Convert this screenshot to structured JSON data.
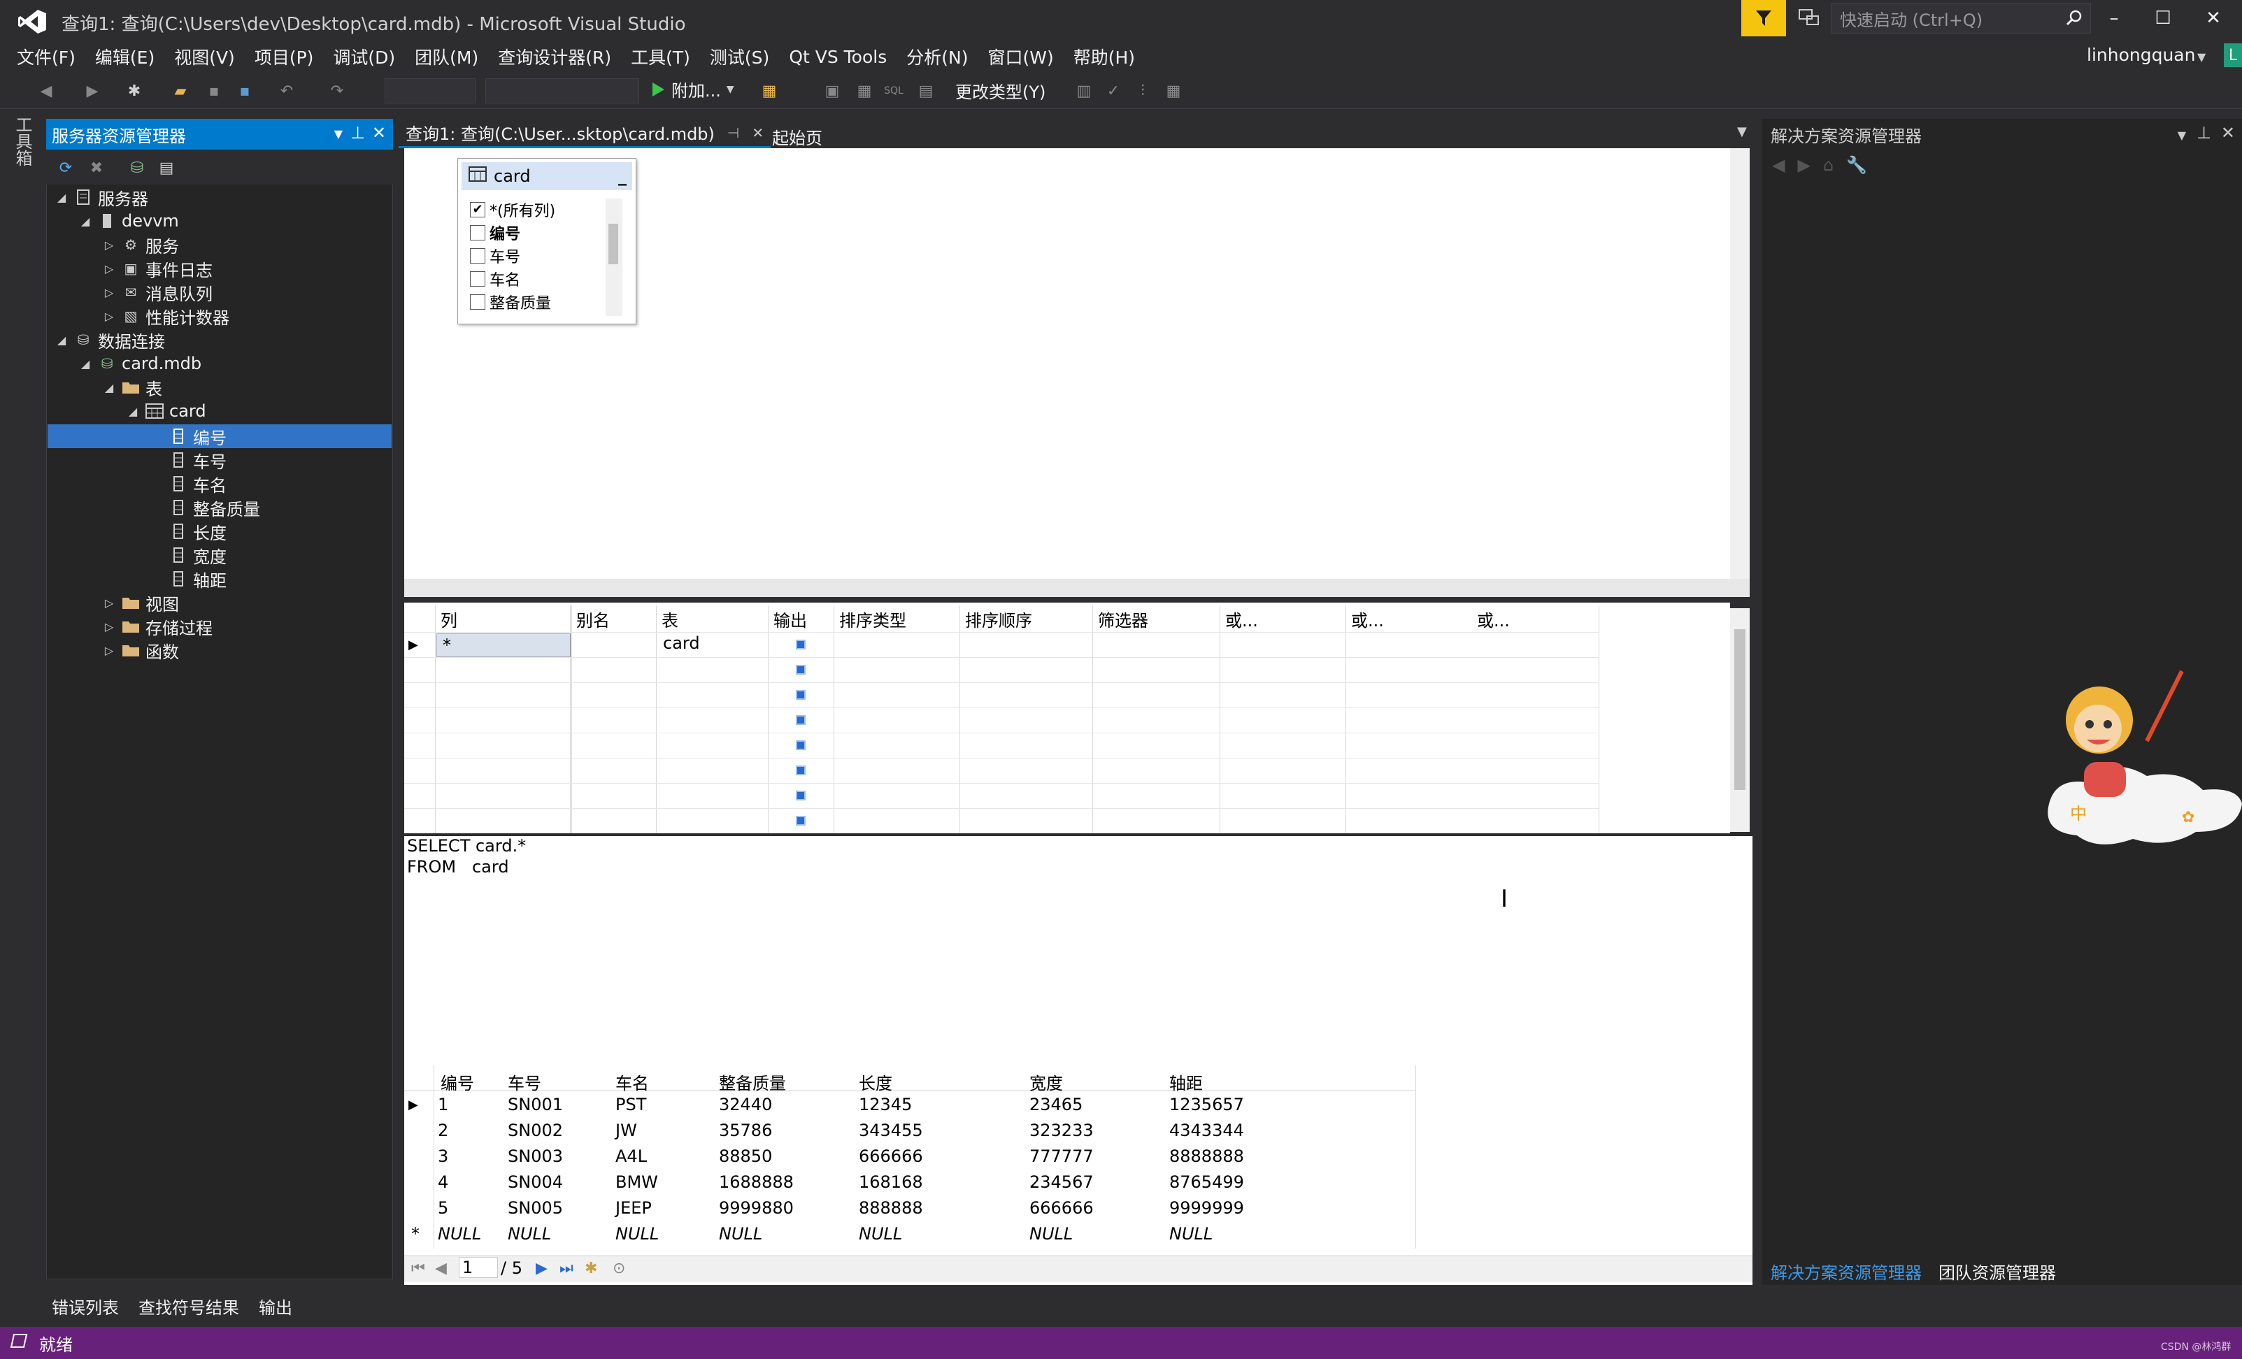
{
  "window": {
    "title": "查询1: 查询(C:\\Users\\dev\\Desktop\\card.mdb) - Microsoft Visual Studio",
    "quick_launch_placeholder": "快速启动 (Ctrl+Q)",
    "minimize": "–",
    "maximize": "☐",
    "close": "✕"
  },
  "menu": [
    "文件(F)",
    "编辑(E)",
    "视图(V)",
    "项目(P)",
    "调试(D)",
    "团队(M)",
    "查询设计器(R)",
    "工具(T)",
    "测试(S)",
    "Qt VS Tools",
    "分析(N)",
    "窗口(W)",
    "帮助(H)"
  ],
  "user": {
    "name": "linhongquan",
    "badge": "L"
  },
  "toolbar": {
    "attach_label": "附加...",
    "change_type_label": "更改类型(Y)"
  },
  "toolbox_label": "工具箱",
  "server_explorer": {
    "title": "服务器资源管理器",
    "tree": [
      {
        "label": "服务器",
        "level": 0,
        "expanded": true,
        "icon": "server-icon"
      },
      {
        "label": "devvm",
        "level": 1,
        "expanded": true,
        "icon": "computer-icon"
      },
      {
        "label": "服务",
        "level": 2,
        "expanded": false,
        "icon": "services-icon"
      },
      {
        "label": "事件日志",
        "level": 2,
        "expanded": false,
        "icon": "eventlog-icon"
      },
      {
        "label": "消息队列",
        "level": 2,
        "expanded": false,
        "icon": "message-queue-icon"
      },
      {
        "label": "性能计数器",
        "level": 2,
        "expanded": false,
        "icon": "perf-counter-icon"
      },
      {
        "label": "数据连接",
        "level": 0,
        "expanded": true,
        "icon": "data-connection-icon"
      },
      {
        "label": "card.mdb",
        "level": 1,
        "expanded": true,
        "icon": "database-icon"
      },
      {
        "label": "表",
        "level": 2,
        "expanded": true,
        "icon": "folder-icon"
      },
      {
        "label": "card",
        "level": 3,
        "expanded": true,
        "icon": "table-icon"
      },
      {
        "label": "编号",
        "level": 4,
        "icon": "column-icon",
        "selected": true
      },
      {
        "label": "车号",
        "level": 4,
        "icon": "column-icon"
      },
      {
        "label": "车名",
        "level": 4,
        "icon": "column-icon"
      },
      {
        "label": "整备质量",
        "level": 4,
        "icon": "column-icon"
      },
      {
        "label": "长度",
        "level": 4,
        "icon": "column-icon"
      },
      {
        "label": "宽度",
        "level": 4,
        "icon": "column-icon"
      },
      {
        "label": "轴距",
        "level": 4,
        "icon": "column-icon"
      },
      {
        "label": "视图",
        "level": 2,
        "expanded": false,
        "icon": "folder-icon"
      },
      {
        "label": "存储过程",
        "level": 2,
        "expanded": false,
        "icon": "folder-icon"
      },
      {
        "label": "函数",
        "level": 2,
        "expanded": false,
        "icon": "folder-icon"
      }
    ]
  },
  "tabs": {
    "active": "查询1: 查询(C:\\User...sktop\\card.mdb)",
    "pin": "⊣",
    "close": "✕",
    "start_page": "起始页"
  },
  "diagram": {
    "table_name": "card",
    "columns": [
      {
        "label": "*(所有列)",
        "checked": true
      },
      {
        "label": "编号",
        "checked": false
      },
      {
        "label": "车号",
        "checked": false
      },
      {
        "label": "车名",
        "checked": false
      },
      {
        "label": "整备质量",
        "checked": false
      }
    ]
  },
  "criteria": {
    "headers": [
      "列",
      "别名",
      "表",
      "输出",
      "排序类型",
      "排序顺序",
      "筛选器",
      "或...",
      "或...",
      "或..."
    ],
    "row": {
      "column": "*",
      "table": "card"
    }
  },
  "sql": {
    "line1": "SELECT card.*",
    "line2": "FROM   card"
  },
  "results": {
    "headers": [
      "编号",
      "车号",
      "车名",
      "整备质量",
      "长度",
      "宽度",
      "轴距"
    ],
    "rows": [
      [
        "1",
        "SN001",
        "PST",
        "32440",
        "12345",
        "23465",
        "1235657"
      ],
      [
        "2",
        "SN002",
        "JW",
        "35786",
        "343455",
        "323233",
        "4343344"
      ],
      [
        "3",
        "SN003",
        "A4L",
        "88850",
        "666666",
        "777777",
        "8888888"
      ],
      [
        "4",
        "SN004",
        "BMW",
        "1688888",
        "168168",
        "234567",
        "8765499"
      ],
      [
        "5",
        "SN005",
        "JEEP",
        "9999880",
        "888888",
        "666666",
        "9999999"
      ]
    ],
    "null_row": [
      "NULL",
      "NULL",
      "NULL",
      "NULL",
      "NULL",
      "NULL",
      "NULL"
    ],
    "new_row_marker": "*",
    "pager": {
      "current": "1",
      "total": "/ 5"
    }
  },
  "solution_explorer": {
    "title": "解决方案资源管理器",
    "tabs": [
      "解决方案资源管理器",
      "团队资源管理器"
    ]
  },
  "bottom_tabs": [
    "错误列表",
    "查找符号结果",
    "输出"
  ],
  "status": {
    "text": "就绪"
  },
  "watermark": "CSDN @林鸿群",
  "colors": {
    "accent": "#007acc",
    "status_bar": "#68217a",
    "selection": "#3174c6",
    "notification": "#f5c40f"
  }
}
